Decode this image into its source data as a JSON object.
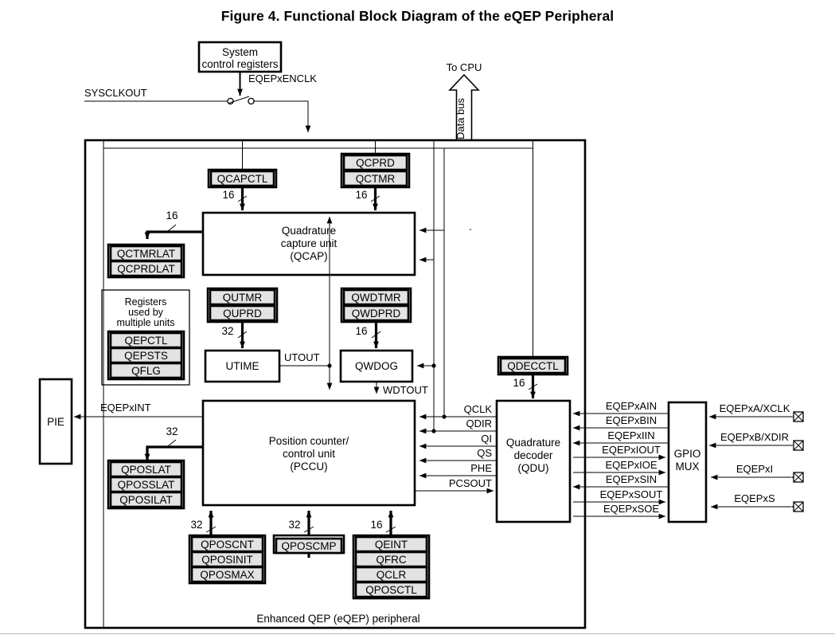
{
  "figure": {
    "title": "Figure 4.  Functional Block Diagram of the eQEP Peripheral",
    "container_caption": "Enhanced QEP (eQEP) peripheral"
  },
  "external": {
    "system_control_registers": {
      "line1": "System",
      "line2": "control registers"
    },
    "enclk_label": "EQEPxENCLK",
    "sysclkout_label": "SYSCLKOUT",
    "to_cpu_label": "To CPU",
    "data_bus_label": "Data bus",
    "pie_label": "PIE",
    "eqepxint_label": "EQEPxINT",
    "gpio_mux": {
      "line1": "GPIO",
      "line2": "MUX"
    }
  },
  "units": {
    "qcap": {
      "line1": "Quadrature",
      "line2": "capture unit",
      "line3": "(QCAP)"
    },
    "pccu": {
      "line1": "Position counter/",
      "line2": "control unit",
      "line3": "(PCCU)"
    },
    "qdu": {
      "line1": "Quadrature",
      "line2": "decoder",
      "line3": "(QDU)"
    },
    "utime": "UTIME",
    "qwdog": "QWDOG"
  },
  "shared_registers_box": {
    "line1": "Registers",
    "line2": "used by",
    "line3": "multiple units",
    "registers": [
      "QEPCTL",
      "QEPSTS",
      "QFLG"
    ]
  },
  "register_groups": {
    "qcapctl": [
      "QCAPCTL"
    ],
    "qcprd_qctmr": [
      "QCPRD",
      "QCTMR"
    ],
    "qctmrlat_qcprdlat": [
      "QCTMRLAT",
      "QCPRDLAT"
    ],
    "qutmr_quprd": [
      "QUTMR",
      "QUPRD"
    ],
    "qwdtmr_qwdprd": [
      "QWDTMR",
      "QWDPRD"
    ],
    "qdecctl": [
      "QDECCTL"
    ],
    "qposlat_group": [
      "QPOSLAT",
      "QPOSSLAT",
      "QPOSILAT"
    ],
    "qposcnt_group": [
      "QPOSCNT",
      "QPOSINIT",
      "QPOSMAX"
    ],
    "qposcmp_group": [
      "QPOSCMP"
    ],
    "qeint_group": [
      "QEINT",
      "QFRC",
      "QCLR",
      "QPOSCTL"
    ]
  },
  "bus_widths": {
    "qcapctl_to_qcap": "16",
    "qctmr_to_qcap": "16",
    "qcap_to_latch": "16",
    "quprd_to_utime": "32",
    "qwdprd_to_qwdog": "16",
    "qdecctl_to_qdu": "16",
    "pccu_to_qposlat": "32",
    "qposcnt_to_pccu": "32",
    "qposcmp_to_pccu": "32",
    "qeint_to_pccu": "16"
  },
  "internal_signals": {
    "utout": "UTOUT",
    "wdtout": "WDTOUT",
    "qdu_to_pccu": [
      "QCLK",
      "QDIR",
      "QI",
      "QS",
      "PHE"
    ],
    "pccu_to_qdu": [
      "PCSOUT"
    ]
  },
  "qdu_gpio_signals": [
    {
      "name": "EQEPxAIN",
      "dir": "in"
    },
    {
      "name": "EQEPxBIN",
      "dir": "in"
    },
    {
      "name": "EQEPxIIN",
      "dir": "in"
    },
    {
      "name": "EQEPxIOUT",
      "dir": "out"
    },
    {
      "name": "EQEPxIOE",
      "dir": "out"
    },
    {
      "name": "EQEPxSIN",
      "dir": "in"
    },
    {
      "name": "EQEPxSOUT",
      "dir": "out"
    },
    {
      "name": "EQEPxSOE",
      "dir": "out"
    }
  ],
  "device_pins": [
    {
      "name": "EQEPxA/XCLK",
      "dir": "in"
    },
    {
      "name": "EQEPxB/XDIR",
      "dir": "in"
    },
    {
      "name": "EQEPxI",
      "dir": "bidi"
    },
    {
      "name": "EQEPxS",
      "dir": "bidi"
    }
  ]
}
